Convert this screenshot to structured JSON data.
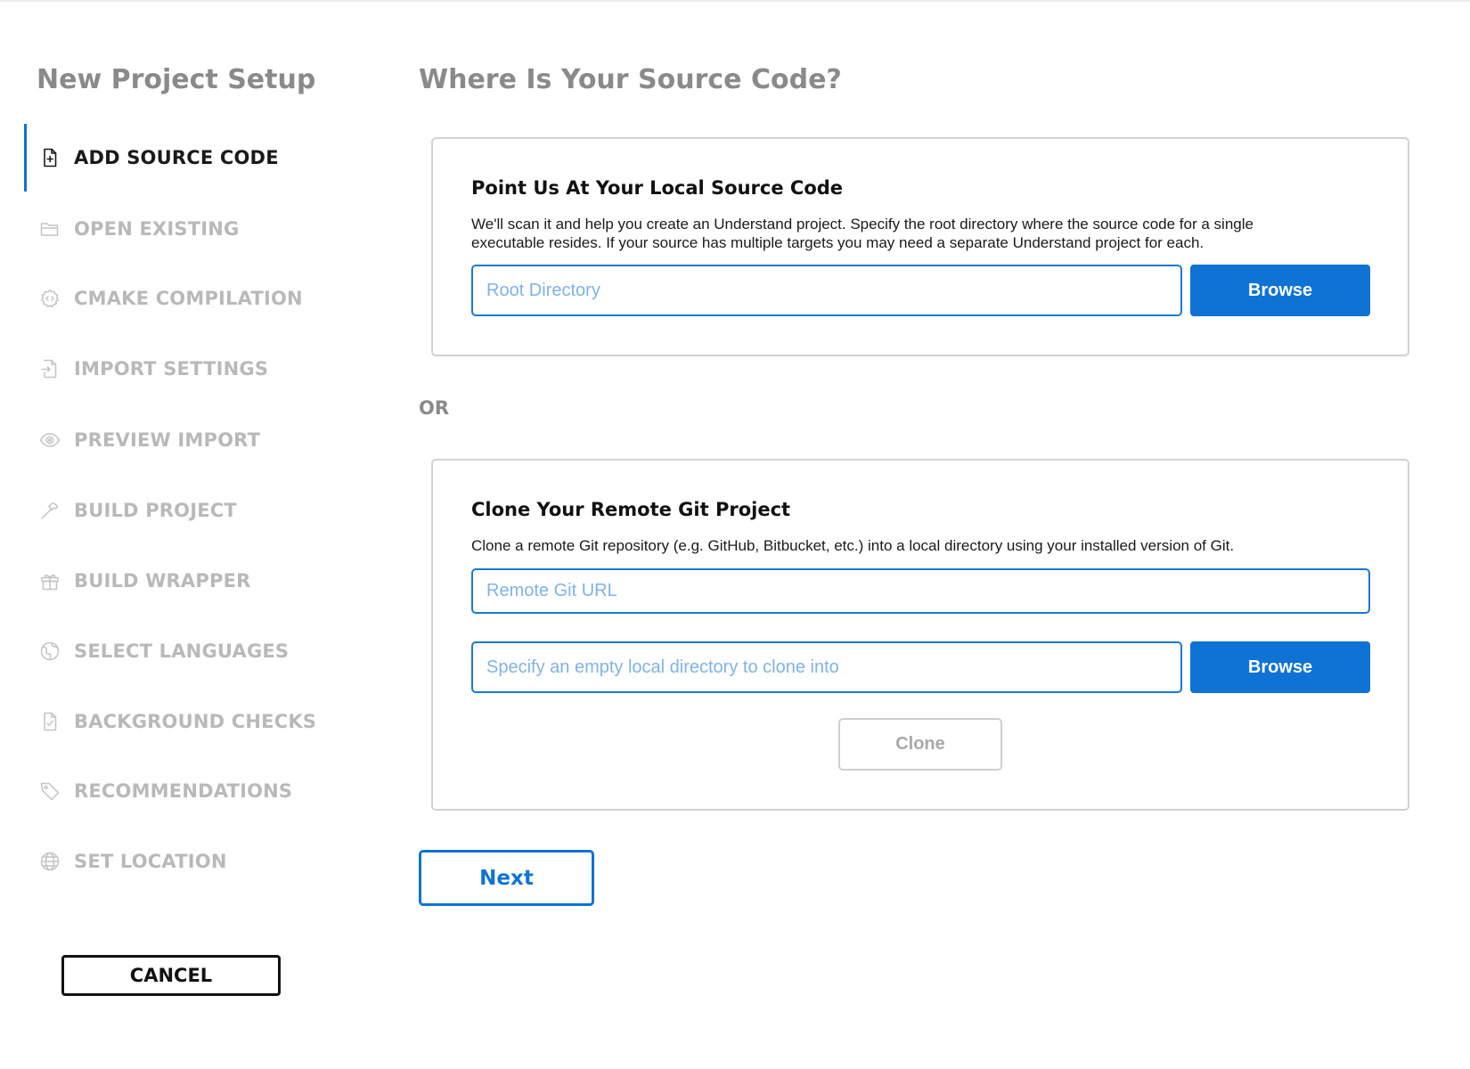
{
  "sidebar": {
    "title": "New Project Setup",
    "steps": [
      {
        "label": "ADD SOURCE CODE",
        "icon": "file-plus-icon",
        "active": true
      },
      {
        "label": "OPEN EXISTING",
        "icon": "folder-open-icon",
        "active": false
      },
      {
        "label": "CMAKE COMPILATION",
        "icon": "gear-code-icon",
        "active": false
      },
      {
        "label": "IMPORT SETTINGS",
        "icon": "file-import-icon",
        "active": false
      },
      {
        "label": "PREVIEW IMPORT",
        "icon": "eye-icon",
        "active": false
      },
      {
        "label": "BUILD PROJECT",
        "icon": "hammer-icon",
        "active": false
      },
      {
        "label": "BUILD WRAPPER",
        "icon": "gift-icon",
        "active": false
      },
      {
        "label": "SELECT LANGUAGES",
        "icon": "globe-swirl-icon",
        "active": false
      },
      {
        "label": "BACKGROUND CHECKS",
        "icon": "file-check-icon",
        "active": false
      },
      {
        "label": "RECOMMENDATIONS",
        "icon": "tag-icon",
        "active": false
      },
      {
        "label": "SET LOCATION",
        "icon": "globe-icon",
        "active": false
      }
    ],
    "cancel_label": "CANCEL"
  },
  "main": {
    "title": "Where Is Your Source Code?",
    "or_label": "OR",
    "next_label": "Next",
    "local": {
      "title": "Point Us At Your Local Source Code",
      "description": "We'll scan it and help you create an Understand project. Specify the root directory where the source code for a single executable resides. If your source has multiple targets you may need a separate Understand project for each.",
      "root_placeholder": "Root Directory",
      "root_value": "",
      "browse_label": "Browse"
    },
    "remote": {
      "title": "Clone Your Remote Git Project",
      "description": "Clone a remote Git repository (e.g. GitHub, Bitbucket, etc.) into a local directory using your installed version of Git.",
      "url_placeholder": "Remote Git URL",
      "url_value": "",
      "dir_placeholder": "Specify an empty local directory to clone into",
      "dir_value": "",
      "browse_label": "Browse",
      "clone_label": "Clone"
    }
  },
  "colors": {
    "accent": "#0e73d4",
    "muted_text": "#b9b9b9",
    "heading_gray": "#8a8a8a",
    "placeholder": "#7fb3e6"
  }
}
